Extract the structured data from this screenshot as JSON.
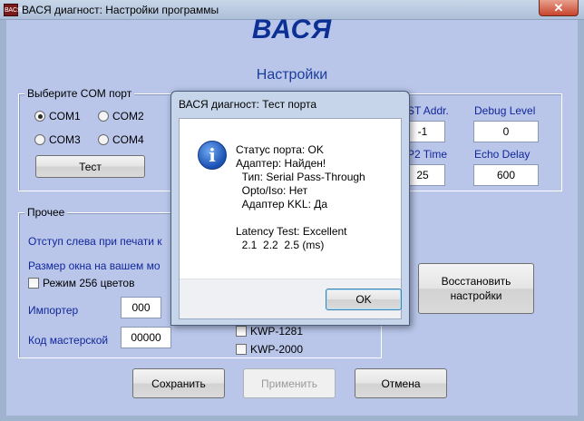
{
  "main_window": {
    "icon_text": "ВАСЯ",
    "title": "ВАСЯ диагност: Настройки программы",
    "close_glyph": "✕"
  },
  "brand": "ВАСЯ",
  "subtitle": "Настройки",
  "com_group": {
    "label": "Выберите COM порт",
    "ports": [
      "COM1",
      "COM2",
      "COM3",
      "COM4"
    ],
    "selected": "COM1",
    "test_button": "Тест"
  },
  "right_params": {
    "addr_label": "ST Addr.",
    "addr_value": "-1",
    "debug_label": "Debug Level",
    "debug_value": "0",
    "p2_label": "P2 Time",
    "p2_value": "25",
    "echo_label": "Echo Delay",
    "echo_value": "600"
  },
  "misc_group": {
    "label": "Прочее",
    "print_offset_label": "Отступ слева при печати к",
    "window_size_label": "Размер окна на вашем мо",
    "mode256_label": "Режим 256 цветов",
    "importer_label": "Импортер",
    "importer_value": "000",
    "workshop_label": "Код мастерской",
    "workshop_value": "00000",
    "kwp1281_label": "KWP-1281",
    "kwp2000_label": "KWP-2000"
  },
  "restore_button": "Восстановить настройки",
  "buttons": {
    "save": "Сохранить",
    "apply": "Применить",
    "cancel": "Отмена"
  },
  "dialog": {
    "title": "ВАСЯ диагност: Тест порта",
    "icon_glyph": "i",
    "lines": [
      "Статус порта: OK",
      "Адаптер: Найден!",
      "  Тип: Serial Pass-Through",
      "  Opto/Iso: Нет",
      "  Адаптер KKL: Да",
      "",
      "Latency Test: Excellent",
      "  2.1  2.2  2.5 (ms)"
    ],
    "ok_button": "OK"
  },
  "colors": {
    "brand": "#0c2f94",
    "label_blue": "#12269a",
    "client_bg": "#b9c6ea"
  }
}
